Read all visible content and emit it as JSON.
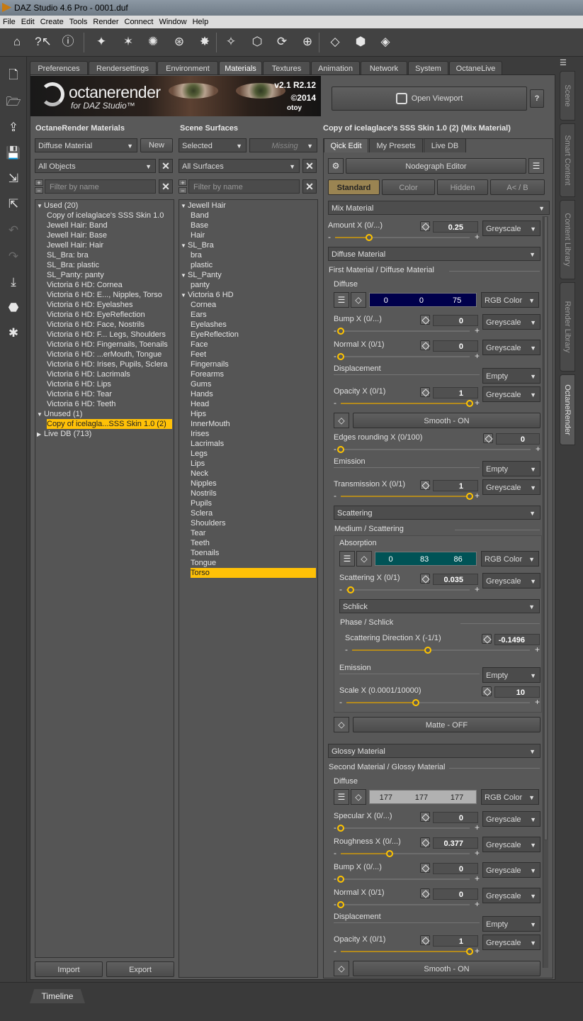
{
  "window": {
    "title": "DAZ Studio 4.6 Pro - 0001.duf"
  },
  "menu": [
    "File",
    "Edit",
    "Create",
    "Tools",
    "Render",
    "Connect",
    "Window",
    "Help"
  ],
  "main_tabs": [
    "Preferences",
    "Rendersettings",
    "Environment",
    "Materials",
    "Textures",
    "Animation",
    "Network",
    "System",
    "OctaneLive"
  ],
  "active_main_tab": "Materials",
  "dock_tabs": [
    "Scene",
    "Smart Content",
    "Content Library",
    "Render Library",
    "OctaneRender"
  ],
  "banner": {
    "brand": "octanerender",
    "brand_sub": "for DAZ Studio™",
    "version": "v2.1  R2.12",
    "copyright": "©2014",
    "company": "otoy"
  },
  "viewport": {
    "open_label": "Open Viewport",
    "help_label": "?"
  },
  "materials_panel": {
    "title": "OctaneRender Materials",
    "type_select": "Diffuse Material",
    "new_label": "New",
    "objects_select": "All Objects",
    "filter_placeholder": "Filter by name",
    "tree": [
      {
        "label": "Used (20)",
        "level": 0,
        "expanded": true
      },
      {
        "label": "Copy of icelaglace's SSS Skin 1.0",
        "level": 1
      },
      {
        "label": "Jewell Hair: Band",
        "level": 1
      },
      {
        "label": "Jewell Hair: Base",
        "level": 1
      },
      {
        "label": "Jewell Hair: Hair",
        "level": 1
      },
      {
        "label": "SL_Bra: bra",
        "level": 1
      },
      {
        "label": "SL_Bra: plastic",
        "level": 1
      },
      {
        "label": "SL_Panty: panty",
        "level": 1
      },
      {
        "label": "Victoria 6 HD: Cornea",
        "level": 1
      },
      {
        "label": "Victoria 6 HD: E..., Nipples, Torso",
        "level": 1
      },
      {
        "label": "Victoria 6 HD: Eyelashes",
        "level": 1
      },
      {
        "label": "Victoria 6 HD: EyeReflection",
        "level": 1
      },
      {
        "label": "Victoria 6 HD: Face, Nostrils",
        "level": 1
      },
      {
        "label": "Victoria 6 HD: F... Legs, Shoulders",
        "level": 1
      },
      {
        "label": "Victoria 6 HD: Fingernails, Toenails",
        "level": 1
      },
      {
        "label": "Victoria 6 HD: ...erMouth, Tongue",
        "level": 1
      },
      {
        "label": "Victoria 6 HD: Irises, Pupils, Sclera",
        "level": 1
      },
      {
        "label": "Victoria 6 HD: Lacrimals",
        "level": 1
      },
      {
        "label": "Victoria 6 HD: Lips",
        "level": 1
      },
      {
        "label": "Victoria 6 HD: Tear",
        "level": 1
      },
      {
        "label": "Victoria 6 HD: Teeth",
        "level": 1
      },
      {
        "label": "Unused (1)",
        "level": 0,
        "expanded": true
      },
      {
        "label": "Copy of icelagla...SSS Skin 1.0 (2)",
        "level": 1,
        "selected": true
      },
      {
        "label": "Live DB (713)",
        "level": 0,
        "expanded": false
      }
    ],
    "import_label": "Import",
    "export_label": "Export"
  },
  "surfaces_panel": {
    "title": "Scene Surfaces",
    "selected_select": "Selected",
    "missing_select": "Missing",
    "surfaces_select": "All Surfaces",
    "filter_placeholder": "Filter by name",
    "tree": [
      {
        "label": "Jewell Hair",
        "level": 0,
        "expanded": true
      },
      {
        "label": "Band",
        "level": 1
      },
      {
        "label": "Base",
        "level": 1
      },
      {
        "label": "Hair",
        "level": 1
      },
      {
        "label": "SL_Bra",
        "level": 0,
        "expanded": true
      },
      {
        "label": "bra",
        "level": 1
      },
      {
        "label": "plastic",
        "level": 1
      },
      {
        "label": "SL_Panty",
        "level": 0,
        "expanded": true
      },
      {
        "label": "panty",
        "level": 1
      },
      {
        "label": "Victoria 6 HD",
        "level": 0,
        "expanded": true
      },
      {
        "label": "Cornea",
        "level": 1
      },
      {
        "label": "Ears",
        "level": 1
      },
      {
        "label": "Eyelashes",
        "level": 1
      },
      {
        "label": "EyeReflection",
        "level": 1
      },
      {
        "label": "Face",
        "level": 1
      },
      {
        "label": "Feet",
        "level": 1
      },
      {
        "label": "Fingernails",
        "level": 1
      },
      {
        "label": "Forearms",
        "level": 1
      },
      {
        "label": "Gums",
        "level": 1
      },
      {
        "label": "Hands",
        "level": 1
      },
      {
        "label": "Head",
        "level": 1
      },
      {
        "label": "Hips",
        "level": 1
      },
      {
        "label": "InnerMouth",
        "level": 1
      },
      {
        "label": "Irises",
        "level": 1
      },
      {
        "label": "Lacrimals",
        "level": 1
      },
      {
        "label": "Legs",
        "level": 1
      },
      {
        "label": "Lips",
        "level": 1
      },
      {
        "label": "Neck",
        "level": 1
      },
      {
        "label": "Nipples",
        "level": 1
      },
      {
        "label": "Nostrils",
        "level": 1
      },
      {
        "label": "Pupils",
        "level": 1
      },
      {
        "label": "Sclera",
        "level": 1
      },
      {
        "label": "Shoulders",
        "level": 1
      },
      {
        "label": "Tear",
        "level": 1
      },
      {
        "label": "Teeth",
        "level": 1
      },
      {
        "label": "Toenails",
        "level": 1
      },
      {
        "label": "Tongue",
        "level": 1
      },
      {
        "label": "Torso",
        "level": 1,
        "selected": true
      }
    ]
  },
  "editor": {
    "title": "Copy of icelaglace's SSS Skin 1.0 (2) (Mix Material)",
    "tabs": [
      "Qick Edit",
      "My Presets",
      "Live DB"
    ],
    "nodegraph_label": "Nodegraph Editor",
    "mode_tabs": [
      "Standard",
      "Color",
      "Hidden",
      "A< / B"
    ],
    "mix_type": "Mix Material",
    "amount": {
      "label": "Amount X (0/...)",
      "value": "0.25",
      "fraction": 0.25,
      "mode": "Greyscale"
    },
    "first_type": "Diffuse Material",
    "first_section": "First Material / Diffuse Material",
    "first": {
      "diffuse_label": "Diffuse",
      "diffuse_rgb": [
        "0",
        "0",
        "75"
      ],
      "diffuse_color": "#00004b",
      "diffuse_mode": "RGB Color",
      "bump": {
        "label": "Bump X (0/...)",
        "value": "0",
        "fraction": 0,
        "mode": "Greyscale"
      },
      "normal": {
        "label": "Normal X (0/1)",
        "value": "0",
        "fraction": 0,
        "mode": "Greyscale"
      },
      "displacement_label": "Displacement",
      "displacement_mode": "Empty",
      "opacity": {
        "label": "Opacity X (0/1)",
        "value": "1",
        "fraction": 1,
        "mode": "Greyscale"
      },
      "smooth_label": "Smooth - ON",
      "edges": {
        "label": "Edges rounding X (0/100)",
        "value": "0",
        "fraction": 0
      },
      "emission_label": "Emission",
      "emission_mode": "Empty",
      "transmission": {
        "label": "Transmission X (0/1)",
        "value": "1",
        "fraction": 1,
        "mode": "Greyscale"
      },
      "scattering_type": "Scattering",
      "medium_label": "Medium / Scattering",
      "absorption_label": "Absorption",
      "absorption_rgb": [
        "0",
        "83",
        "86"
      ],
      "absorption_color": "#005356",
      "absorption_mode": "RGB Color",
      "scattering": {
        "label": "Scattering X (0/1)",
        "value": "0.035",
        "fraction": 0.035,
        "mode": "Greyscale"
      },
      "phase_type": "Schlick",
      "phase_label": "Phase / Schlick",
      "direction": {
        "label": "Scattering Direction X (-1/1)",
        "value": "-0.1496",
        "fraction": 0.425
      },
      "medium_emission_label": "Emission",
      "medium_emission_mode": "Empty",
      "scale": {
        "label": "Scale X (0.0001/10000)",
        "value": "10",
        "fraction": 0.38
      },
      "matte_label": "Matte - OFF"
    },
    "second_type": "Glossy Material",
    "second_section": "Second Material / Glossy Material",
    "second": {
      "diffuse_label": "Diffuse",
      "diffuse_rgb": [
        "177",
        "177",
        "177"
      ],
      "diffuse_color": "#b1b1b1",
      "diffuse_mode": "RGB Color",
      "specular": {
        "label": "Specular X (0/...)",
        "value": "0",
        "fraction": 0,
        "mode": "Greyscale"
      },
      "roughness": {
        "label": "Roughness X (0/...)",
        "value": "0.377",
        "fraction": 0.377,
        "mode": "Greyscale"
      },
      "bump": {
        "label": "Bump X (0/...)",
        "value": "0",
        "fraction": 0,
        "mode": "Greyscale"
      },
      "normal": {
        "label": "Normal X (0/1)",
        "value": "0",
        "fraction": 0,
        "mode": "Greyscale"
      },
      "displacement_label": "Displacement",
      "displacement_mode": "Empty",
      "opacity": {
        "label": "Opacity X (0/1)",
        "value": "1",
        "fraction": 1,
        "mode": "Greyscale"
      },
      "smooth_label": "Smooth - ON"
    }
  },
  "timeline_label": "Timeline"
}
